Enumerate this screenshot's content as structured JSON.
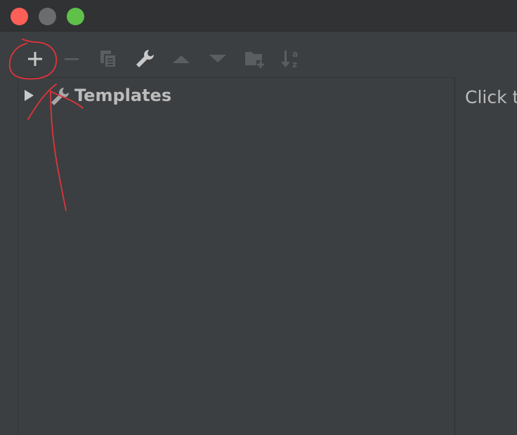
{
  "window": {
    "buttons": {
      "close_color": "#fe5f57",
      "minimize_color": "#6a6c6e",
      "zoom_color": "#5fc14a"
    }
  },
  "toolbar": {
    "items": [
      {
        "name": "add",
        "icon": "plus-icon",
        "enabled": true
      },
      {
        "name": "remove",
        "icon": "minus-icon",
        "enabled": false
      },
      {
        "name": "copy",
        "icon": "copy-icon",
        "enabled": false
      },
      {
        "name": "settings",
        "icon": "wrench-icon",
        "enabled": true
      },
      {
        "name": "move-up",
        "icon": "triangle-up-icon",
        "enabled": false
      },
      {
        "name": "move-down",
        "icon": "triangle-down-icon",
        "enabled": false
      },
      {
        "name": "new-group",
        "icon": "folder-plus-icon",
        "enabled": false
      },
      {
        "name": "sort",
        "icon": "sort-az-icon",
        "enabled": false
      }
    ]
  },
  "tree": {
    "items": [
      {
        "label": "Templates",
        "icon": "wrench-icon",
        "expanded": false
      }
    ]
  },
  "details": {
    "hint": "Click t"
  },
  "colors": {
    "background": "#3c3f41",
    "titlebar": "#303234",
    "text": "#bbbbbb",
    "annotation": "#e0343c"
  }
}
